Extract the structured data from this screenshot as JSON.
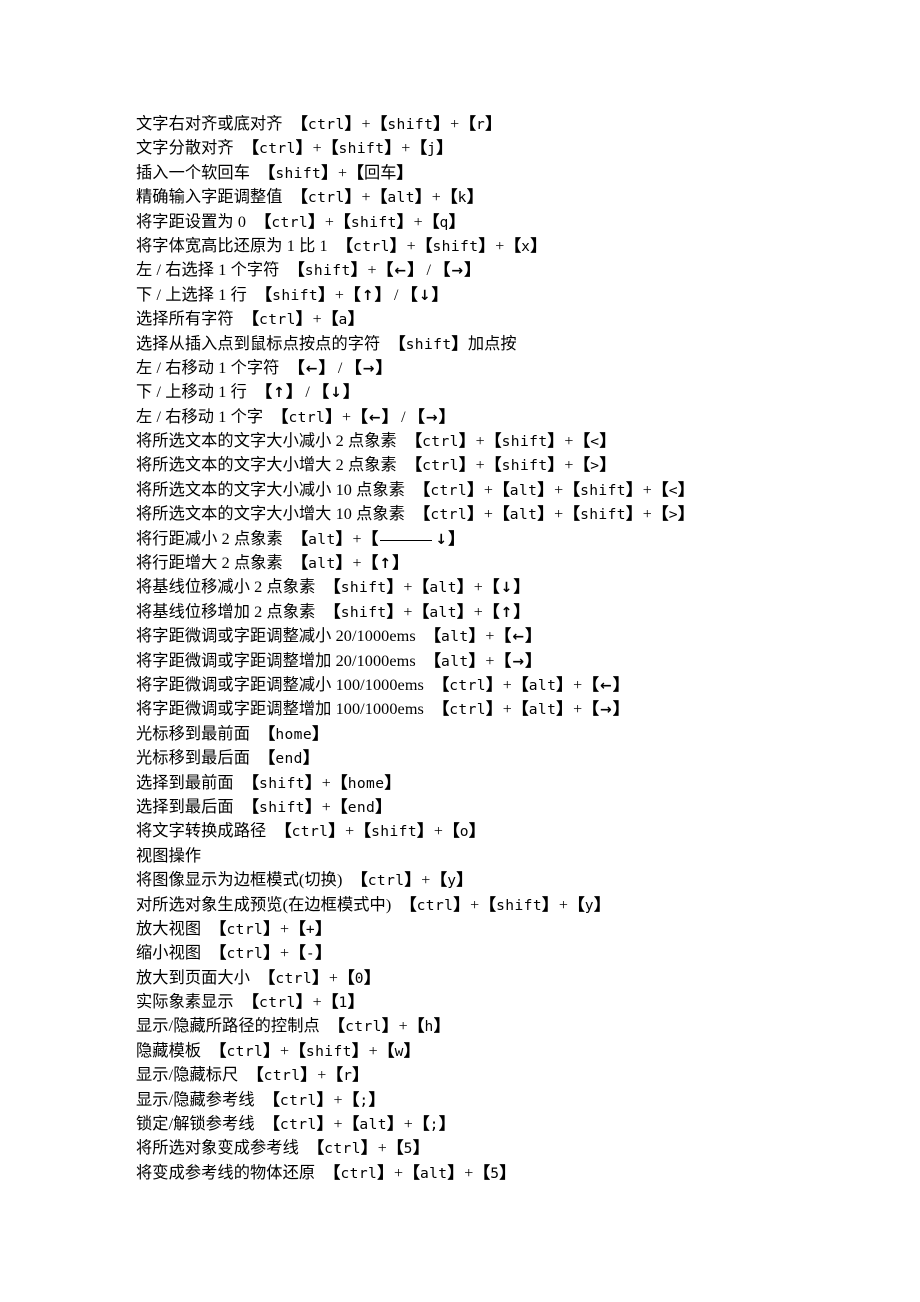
{
  "document": {
    "background_color": "#ffffff",
    "text_color": "#000000",
    "bracket_open": "【",
    "bracket_close": "】",
    "plus": "+",
    "slash": "/",
    "arrow_left": "←",
    "arrow_right": "→",
    "arrow_up": "↑",
    "arrow_down": "↓"
  },
  "lines": [
    {
      "id": "text-align-right-bottom",
      "desc": "文字右对齐或底对齐",
      "keys": [
        "ctrl",
        "shift",
        "r"
      ]
    },
    {
      "id": "text-justify",
      "desc": "文字分散对齐",
      "keys": [
        "ctrl",
        "shift",
        "j"
      ]
    },
    {
      "id": "insert-soft-return",
      "desc": "插入一个软回车",
      "keys": [
        "shift",
        "回车"
      ]
    },
    {
      "id": "exact-kerning-value",
      "desc": "精确输入字距调整值",
      "keys": [
        "ctrl",
        "alt",
        "k"
      ]
    },
    {
      "id": "set-kerning-zero",
      "desc": "将字距设置为 0",
      "keys": [
        "ctrl",
        "shift",
        "q"
      ]
    },
    {
      "id": "reset-font-aspect-ratio",
      "desc": "将字体宽高比还原为 1 比 1",
      "keys": [
        "ctrl",
        "shift",
        "x"
      ]
    },
    {
      "id": "select-one-char-left-right",
      "desc": "左 / 右选择 1 个字符",
      "keys": [
        "shift",
        "←"
      ],
      "alt_keys": [
        "→"
      ]
    },
    {
      "id": "select-one-line-down-up",
      "desc": "下 / 上选择 1 行",
      "keys": [
        "shift",
        "↑"
      ],
      "alt_keys": [
        "↓"
      ]
    },
    {
      "id": "select-all-chars",
      "desc": "选择所有字符",
      "keys": [
        "ctrl",
        "a"
      ]
    },
    {
      "id": "select-from-caret-to-click",
      "desc": "选择从插入点到鼠标点按点的字符",
      "keys": [
        "shift"
      ],
      "suffix": "加点按"
    },
    {
      "id": "move-one-char-left-right",
      "desc": "左 / 右移动 1 个字符",
      "keys": [
        "←"
      ],
      "alt_keys": [
        "→"
      ]
    },
    {
      "id": "move-one-line-down-up",
      "desc": "下 / 上移动 1 行",
      "keys": [
        "↑"
      ],
      "alt_keys": [
        "↓"
      ]
    },
    {
      "id": "move-one-word-left-right",
      "desc": "左 / 右移动 1 个字",
      "keys": [
        "ctrl",
        "←"
      ],
      "alt_keys": [
        "→"
      ]
    },
    {
      "id": "decrease-font-size-2px",
      "desc": "将所选文本的文字大小减小 2 点象素",
      "keys": [
        "ctrl",
        "shift",
        "<"
      ]
    },
    {
      "id": "increase-font-size-2px",
      "desc": "将所选文本的文字大小增大 2 点象素",
      "keys": [
        "ctrl",
        "shift",
        ">"
      ]
    },
    {
      "id": "decrease-font-size-10px",
      "desc": "将所选文本的文字大小减小 10 点象素",
      "keys": [
        "ctrl",
        "alt",
        "shift",
        "<"
      ]
    },
    {
      "id": "increase-font-size-10px",
      "desc": "将所选文本的文字大小增大 10 点象素",
      "keys": [
        "ctrl",
        "alt",
        "shift",
        ">"
      ]
    },
    {
      "id": "decrease-leading-2px",
      "desc": "将行距减小 2 点象素",
      "keys": [
        "alt",
        "__RULE____↓"
      ]
    },
    {
      "id": "increase-leading-2px",
      "desc": "将行距增大 2 点象素",
      "keys": [
        "alt",
        "↑"
      ]
    },
    {
      "id": "decrease-baseline-shift-2px",
      "desc": "将基线位移减小 2 点象素",
      "keys": [
        "shift",
        "alt",
        "↓"
      ]
    },
    {
      "id": "increase-baseline-shift-2px",
      "desc": "将基线位移增加 2 点象素",
      "keys": [
        "shift",
        "alt",
        "↑"
      ]
    },
    {
      "id": "decrease-kerning-20",
      "desc": "将字距微调或字距调整减小 20/1000ems",
      "keys": [
        "alt",
        "←"
      ]
    },
    {
      "id": "increase-kerning-20",
      "desc": "将字距微调或字距调整增加 20/1000ems",
      "keys": [
        "alt",
        "→"
      ]
    },
    {
      "id": "decrease-kerning-100",
      "desc": "将字距微调或字距调整减小 100/1000ems",
      "keys": [
        "ctrl",
        "alt",
        "←"
      ]
    },
    {
      "id": "increase-kerning-100",
      "desc": "将字距微调或字距调整增加 100/1000ems",
      "keys": [
        "ctrl",
        "alt",
        "→"
      ]
    },
    {
      "id": "cursor-to-start",
      "desc": "光标移到最前面",
      "keys": [
        "home"
      ]
    },
    {
      "id": "cursor-to-end",
      "desc": "光标移到最后面",
      "keys": [
        "end"
      ]
    },
    {
      "id": "select-to-start",
      "desc": "选择到最前面",
      "keys": [
        "shift",
        "home"
      ]
    },
    {
      "id": "select-to-end",
      "desc": "选择到最后面",
      "keys": [
        "shift",
        "end"
      ]
    },
    {
      "id": "convert-text-to-path",
      "desc": "将文字转换成路径",
      "keys": [
        "ctrl",
        "shift",
        "o"
      ]
    },
    {
      "id": "section-view-operations",
      "desc": "视图操作",
      "keys": [],
      "is_section": true
    },
    {
      "id": "toggle-outline-mode",
      "desc": "将图像显示为边框模式(切换)",
      "keys": [
        "ctrl",
        "y"
      ]
    },
    {
      "id": "preview-selection-in-outline",
      "desc": "对所选对象生成预览(在边框模式中)",
      "keys": [
        "ctrl",
        "shift",
        "y"
      ]
    },
    {
      "id": "zoom-in",
      "desc": "放大视图",
      "keys": [
        "ctrl",
        "+"
      ]
    },
    {
      "id": "zoom-out",
      "desc": "缩小视图",
      "keys": [
        "ctrl",
        "-"
      ]
    },
    {
      "id": "fit-page",
      "desc": "放大到页面大小",
      "keys": [
        "ctrl",
        "0"
      ]
    },
    {
      "id": "actual-pixels",
      "desc": "实际象素显示",
      "keys": [
        "ctrl",
        "1"
      ]
    },
    {
      "id": "toggle-path-control-points",
      "desc": "显示/隐藏所路径的控制点",
      "keys": [
        "ctrl",
        "h"
      ]
    },
    {
      "id": "hide-template",
      "desc": "隐藏模板",
      "keys": [
        "ctrl",
        "shift",
        "w"
      ]
    },
    {
      "id": "toggle-rulers",
      "desc": "显示/隐藏标尺",
      "keys": [
        "ctrl",
        "r"
      ]
    },
    {
      "id": "toggle-guides",
      "desc": "显示/隐藏参考线",
      "keys": [
        "ctrl",
        ";"
      ]
    },
    {
      "id": "lock-unlock-guides",
      "desc": "锁定/解锁参考线",
      "keys": [
        "ctrl",
        "alt",
        ";"
      ]
    },
    {
      "id": "make-guides-from-selection",
      "desc": "将所选对象变成参考线",
      "keys": [
        "ctrl",
        "5"
      ]
    },
    {
      "id": "release-guides",
      "desc": "将变成参考线的物体还原",
      "keys": [
        "ctrl",
        "alt",
        "5"
      ]
    }
  ]
}
